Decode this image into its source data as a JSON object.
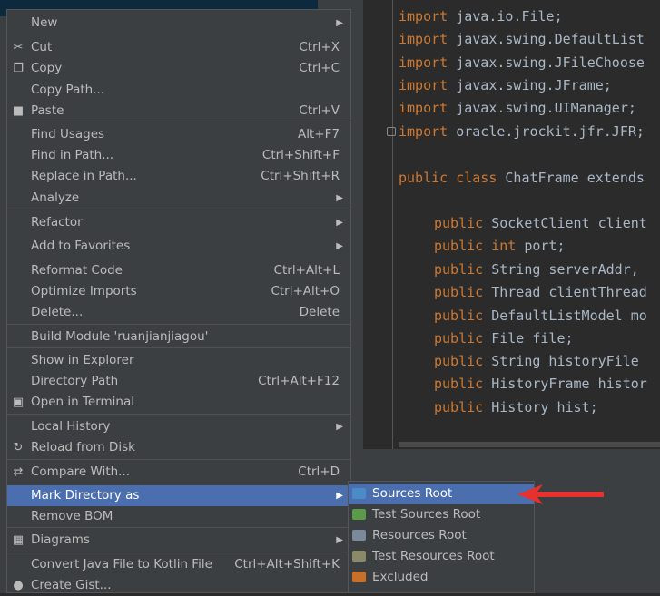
{
  "code": {
    "lines": [
      {
        "kw": "import",
        "rest": " java.io.File;"
      },
      {
        "kw": "import",
        "rest": " javax.swing.DefaultList"
      },
      {
        "kw": "import",
        "rest": " javax.swing.JFileChoose"
      },
      {
        "kw": "import",
        "rest": " javax.swing.JFrame;"
      },
      {
        "kw": "import",
        "rest": " javax.swing.UIManager;"
      },
      {
        "kw": "import",
        "rest": " oracle.jrockit.jfr.JFR;"
      },
      {
        "kw": "public class",
        "rest": " ChatFrame extends"
      },
      {
        "kw": "public",
        "rest": " SocketClient client"
      },
      {
        "kw": "public int",
        "rest": " port;"
      },
      {
        "kw": "public",
        "rest": " String serverAddr,"
      },
      {
        "kw": "public",
        "rest": " Thread clientThread"
      },
      {
        "kw": "public",
        "rest": " DefaultListModel mo"
      },
      {
        "kw": "public",
        "rest": " File file;"
      },
      {
        "kw": "public",
        "rest": " String historyFile"
      },
      {
        "kw": "public",
        "rest": " HistoryFrame histor"
      },
      {
        "kw": "public",
        "rest": " History hist;"
      }
    ]
  },
  "menu": {
    "items": [
      {
        "label": "New",
        "shortcut": "",
        "submenu": true,
        "icon": ""
      },
      {
        "label": "Cut",
        "shortcut": "Ctrl+X",
        "submenu": false,
        "icon": "scissors-icon"
      },
      {
        "label": "Copy",
        "shortcut": "Ctrl+C",
        "submenu": false,
        "icon": "copy-icon"
      },
      {
        "label": "Copy Path...",
        "shortcut": "",
        "submenu": false,
        "icon": ""
      },
      {
        "label": "Paste",
        "shortcut": "Ctrl+V",
        "submenu": false,
        "icon": "paste-icon"
      },
      {
        "label": "Find Usages",
        "shortcut": "Alt+F7",
        "submenu": false,
        "icon": ""
      },
      {
        "label": "Find in Path...",
        "shortcut": "Ctrl+Shift+F",
        "submenu": false,
        "icon": ""
      },
      {
        "label": "Replace in Path...",
        "shortcut": "Ctrl+Shift+R",
        "submenu": false,
        "icon": ""
      },
      {
        "label": "Analyze",
        "shortcut": "",
        "submenu": true,
        "icon": ""
      },
      {
        "label": "Refactor",
        "shortcut": "",
        "submenu": true,
        "icon": ""
      },
      {
        "label": "Add to Favorites",
        "shortcut": "",
        "submenu": true,
        "icon": ""
      },
      {
        "label": "Reformat Code",
        "shortcut": "Ctrl+Alt+L",
        "submenu": false,
        "icon": ""
      },
      {
        "label": "Optimize Imports",
        "shortcut": "Ctrl+Alt+O",
        "submenu": false,
        "icon": ""
      },
      {
        "label": "Delete...",
        "shortcut": "Delete",
        "submenu": false,
        "icon": ""
      },
      {
        "label": "Build Module 'ruanjianjiagou'",
        "shortcut": "",
        "submenu": false,
        "icon": ""
      },
      {
        "label": "Show in Explorer",
        "shortcut": "",
        "submenu": false,
        "icon": ""
      },
      {
        "label": "Directory Path",
        "shortcut": "Ctrl+Alt+F12",
        "submenu": false,
        "icon": ""
      },
      {
        "label": "Open in Terminal",
        "shortcut": "",
        "submenu": false,
        "icon": "terminal-icon"
      },
      {
        "label": "Local History",
        "shortcut": "",
        "submenu": true,
        "icon": ""
      },
      {
        "label": "Reload from Disk",
        "shortcut": "",
        "submenu": false,
        "icon": "reload-icon"
      },
      {
        "label": "Compare With...",
        "shortcut": "Ctrl+D",
        "submenu": false,
        "icon": "compare-icon"
      },
      {
        "label": "Mark Directory as",
        "shortcut": "",
        "submenu": true,
        "icon": "",
        "selected": true
      },
      {
        "label": "Remove BOM",
        "shortcut": "",
        "submenu": false,
        "icon": ""
      },
      {
        "label": "Diagrams",
        "shortcut": "",
        "submenu": true,
        "icon": "diagram-icon"
      },
      {
        "label": "Convert Java File to Kotlin File",
        "shortcut": "Ctrl+Alt+Shift+K",
        "submenu": false,
        "icon": ""
      },
      {
        "label": "Create Gist...",
        "shortcut": "",
        "submenu": false,
        "icon": "github-icon"
      }
    ]
  },
  "submenu": {
    "items": [
      {
        "label": "Sources Root",
        "color": "#4a8cc7",
        "selected": true
      },
      {
        "label": "Test Sources Root",
        "color": "#5a9a48"
      },
      {
        "label": "Resources Root",
        "color": "#7a8a9a"
      },
      {
        "label": "Test Resources Root",
        "color": "#8a8a6a"
      },
      {
        "label": "Excluded",
        "color": "#c8702a"
      }
    ]
  },
  "colors": {
    "selection": "#4b6eaf",
    "annotation_arrow": "#e8302c"
  }
}
